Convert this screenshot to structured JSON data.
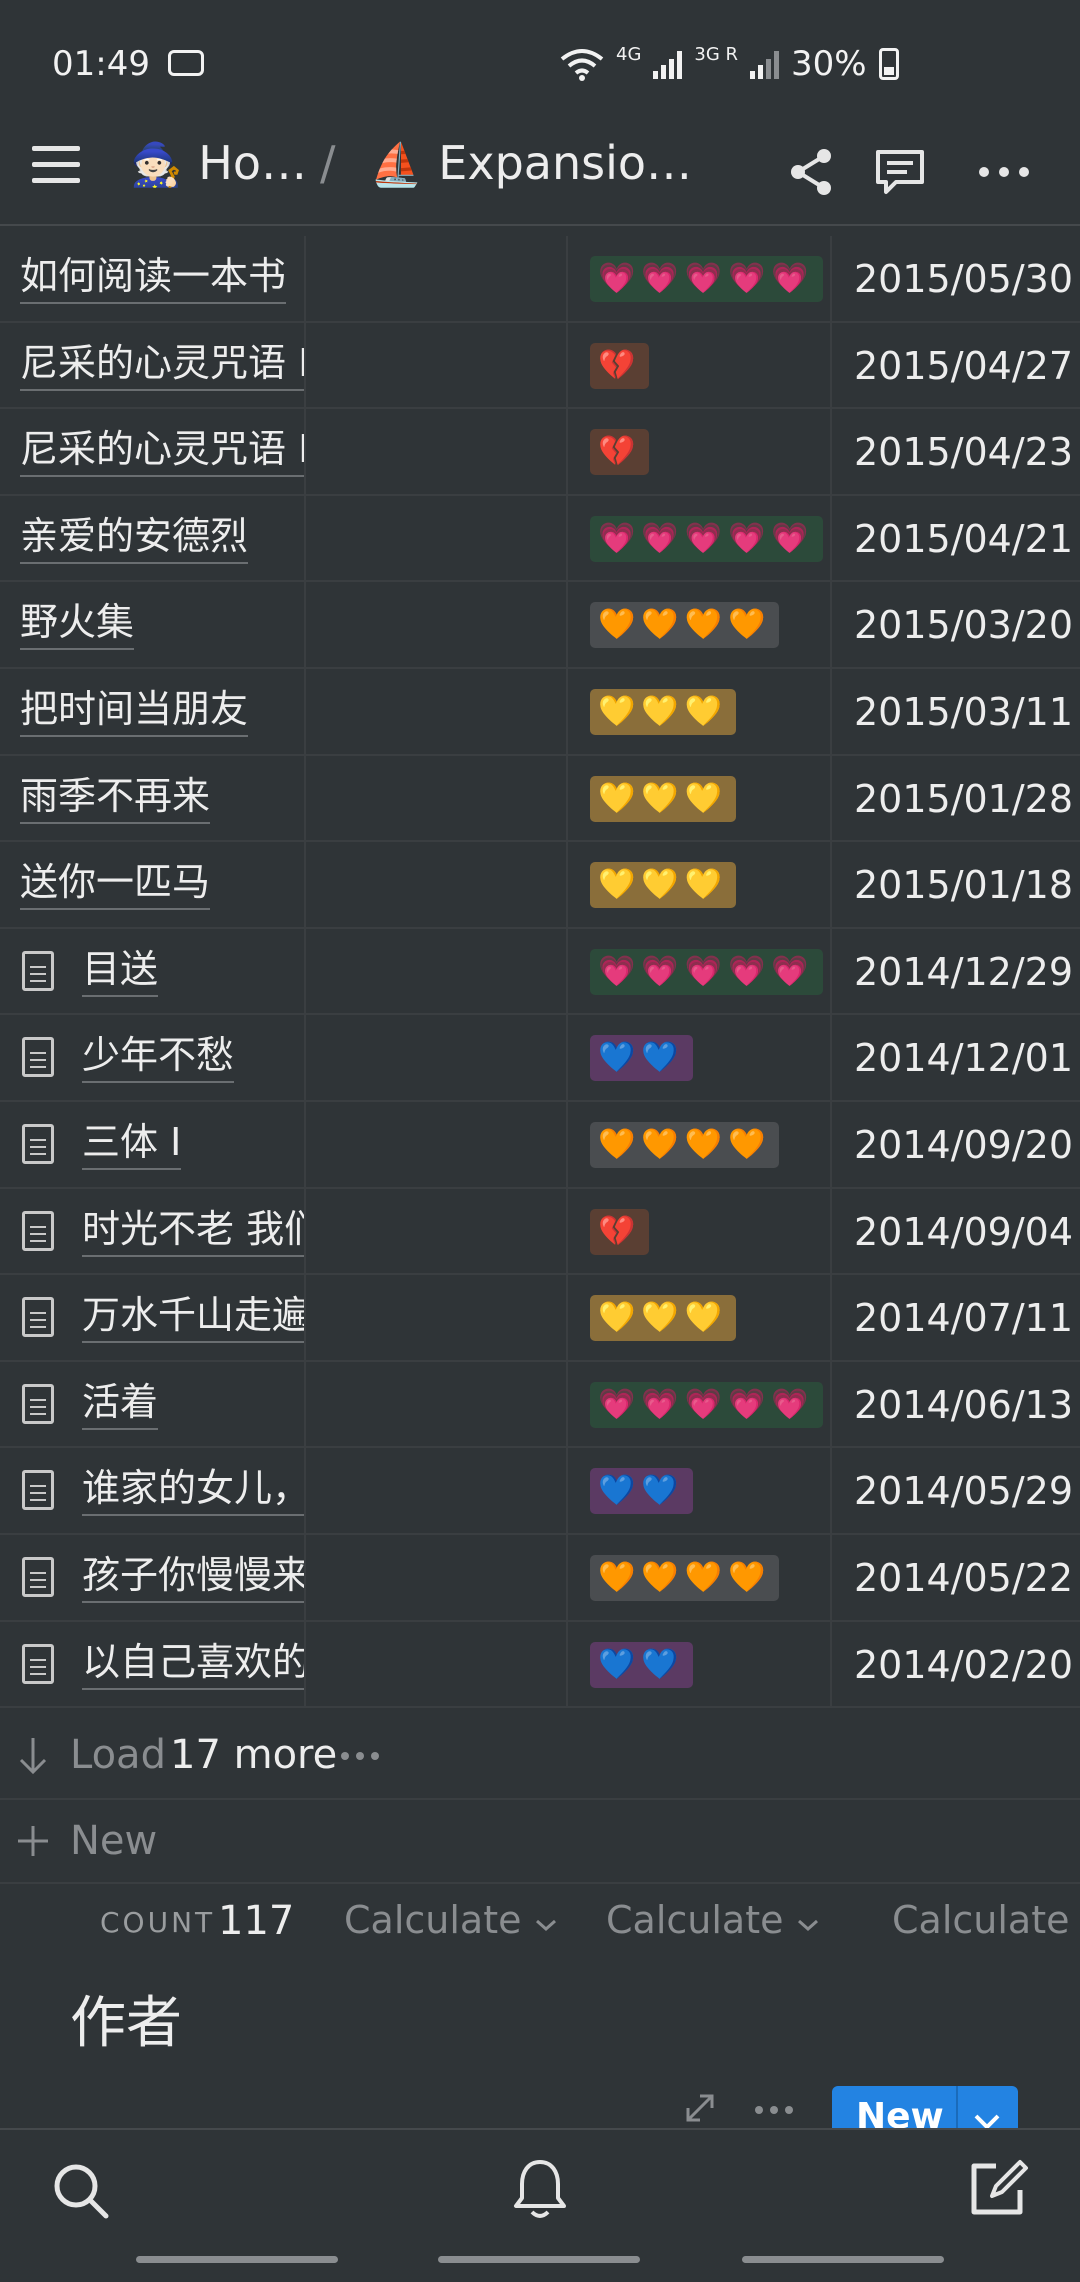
{
  "status_bar": {
    "time": "01:49",
    "network1": "4G",
    "network2": "3G R",
    "battery": "30%"
  },
  "header": {
    "breadcrumb_1_emoji": "🧙🏻",
    "breadcrumb_1": "Ho…",
    "separator": "/",
    "breadcrumb_2_emoji": "⛵",
    "breadcrumb_2": "Expansio…"
  },
  "rows": [
    {
      "title": "如何阅读一本书",
      "doc": false,
      "rating": "💗💗💗💗💗",
      "tag_color": "#2c4a3a",
      "date": "2015/05/30"
    },
    {
      "title": "尼采的心灵咒语 I",
      "doc": false,
      "rating": "💔",
      "tag_color": "#5a3f33",
      "date": "2015/04/27"
    },
    {
      "title": "尼采的心灵咒语 I",
      "doc": false,
      "rating": "💔",
      "tag_color": "#5a3f33",
      "date": "2015/04/23"
    },
    {
      "title": "亲爱的安德烈",
      "doc": false,
      "rating": "💗💗💗💗💗",
      "tag_color": "#2c4a3a",
      "date": "2015/04/21"
    },
    {
      "title": "野火集",
      "doc": false,
      "rating": "🧡🧡🧡🧡",
      "tag_color": "#4a4d50",
      "date": "2015/03/20"
    },
    {
      "title": "把时间当朋友",
      "doc": false,
      "rating": "💛💛💛",
      "tag_color": "#8a6e3a",
      "date": "2015/03/11"
    },
    {
      "title": "雨季不再来",
      "doc": false,
      "rating": "💛💛💛",
      "tag_color": "#8a6e3a",
      "date": "2015/01/28"
    },
    {
      "title": "送你一匹马",
      "doc": false,
      "rating": "💛💛💛",
      "tag_color": "#8a6e3a",
      "date": "2015/01/18"
    },
    {
      "title": "目送",
      "doc": true,
      "rating": "💗💗💗💗💗",
      "tag_color": "#2c4a3a",
      "date": "2014/12/29"
    },
    {
      "title": "少年不愁",
      "doc": true,
      "rating": "💙💙",
      "tag_color": "#5b3a63",
      "date": "2014/12/01"
    },
    {
      "title": "三体 I",
      "doc": true,
      "rating": "🧡🧡🧡🧡",
      "tag_color": "#4a4d50",
      "date": "2014/09/20"
    },
    {
      "title": "时光不老 我们",
      "doc": true,
      "rating": "💔",
      "tag_color": "#5a3f33",
      "date": "2014/09/04"
    },
    {
      "title": "万水千山走遍",
      "doc": true,
      "rating": "💛💛💛",
      "tag_color": "#8a6e3a",
      "date": "2014/07/11"
    },
    {
      "title": "活着",
      "doc": true,
      "rating": "💗💗💗💗💗",
      "tag_color": "#2c4a3a",
      "date": "2014/06/13"
    },
    {
      "title": "谁家的女儿，",
      "doc": true,
      "rating": "💙💙",
      "tag_color": "#5b3a63",
      "date": "2014/05/29"
    },
    {
      "title": "孩子你慢慢来",
      "doc": true,
      "rating": "🧡🧡🧡🧡",
      "tag_color": "#4a4d50",
      "date": "2014/05/22"
    },
    {
      "title": "以自己喜欢的",
      "doc": true,
      "rating": "💙💙",
      "tag_color": "#5b3a63",
      "date": "2014/02/20"
    }
  ],
  "load_more": {
    "prefix": "Load",
    "count_text": "17 more"
  },
  "new_row": {
    "label": "New"
  },
  "calc": {
    "count_label": "COUNT",
    "count_value": "117",
    "calc1": "Calculate",
    "calc2": "Calculate",
    "calc3": "Calculate"
  },
  "section": {
    "title": "作者"
  },
  "mini_toolbar": {
    "new_label": "New"
  }
}
